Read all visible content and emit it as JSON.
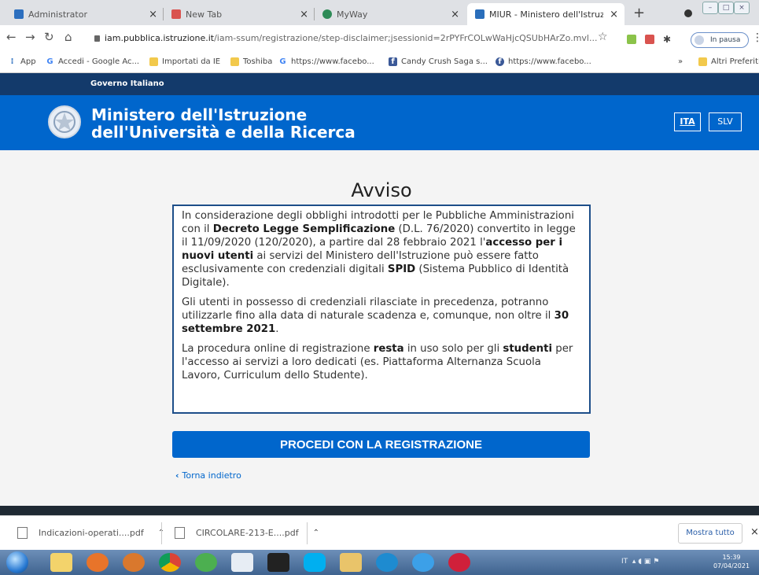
{
  "browser": {
    "tabs": [
      {
        "title": "Administrator",
        "icon": "outlook-icon",
        "color": "#2c6fbf"
      },
      {
        "title": "New Tab",
        "icon": "newtab-icon",
        "color": "#d9534f"
      },
      {
        "title": "MyWay",
        "icon": "myway-icon",
        "color": "#2e8b57"
      },
      {
        "title": "MIUR - Ministero dell'Istruzion",
        "icon": "miur-icon",
        "color": "#2a6ebb",
        "active": true
      }
    ],
    "new_tab": "+",
    "url_host": "iam.pubblica.istruzione.it",
    "url_path": "/iam-ssum/registrazione/step-disclaimer;jsessionid=2rPYFrCOLwWaHjcQSUbHArZo.mvl...",
    "pause_label": "In pausa",
    "bookmarks": [
      {
        "label": "App",
        "icon": "apps-icon"
      },
      {
        "label": "Accedi - Google Ac...",
        "icon": "google-icon"
      },
      {
        "label": "Importati da IE",
        "icon": "folder-icon"
      },
      {
        "label": "Toshiba",
        "icon": "folder-icon"
      },
      {
        "label": "https://www.facebo...",
        "icon": "google-icon"
      },
      {
        "label": "Candy Crush Saga s...",
        "icon": "facebook-icon"
      },
      {
        "label": "https://www.facebo...",
        "icon": "facebook-round-icon"
      }
    ],
    "bookmarks_overflow": "»",
    "other_bookmarks": "Altri Preferiti"
  },
  "page": {
    "gov_label": "Governo Italiano",
    "ministry_line1": "Ministero dell'Istruzione",
    "ministry_line2": "dell'Università e della Ricerca",
    "lang_ita": "ITA",
    "lang_slv": "SLV",
    "notice_title": "Avviso",
    "p1": [
      {
        "t": "In considerazione degli obblighi introdotti per le Pubbliche Amministrazioni con il ",
        "b": false
      },
      {
        "t": "Decreto Legge Semplificazione",
        "b": true
      },
      {
        "t": " (D.L. 76/2020) convertito in legge il 11/09/2020 (120/2020), a partire dal 28 febbraio 2021 l'",
        "b": false
      },
      {
        "t": "accesso per i nuovi utenti",
        "b": true
      },
      {
        "t": " ai servizi del Ministero dell'Istruzione può essere fatto esclusivamente con credenziali digitali ",
        "b": false
      },
      {
        "t": "SPID",
        "b": true
      },
      {
        "t": " (Sistema Pubblico di Identità Digitale).",
        "b": false
      }
    ],
    "p2": [
      {
        "t": "Gli utenti in possesso di credenziali rilasciate in precedenza, potranno utilizzarle fino alla data di naturale scadenza e, comunque, non oltre il ",
        "b": false
      },
      {
        "t": "30 settembre 2021",
        "b": true
      },
      {
        "t": ".",
        "b": false
      }
    ],
    "p3": [
      {
        "t": "La procedura online di registrazione ",
        "b": false
      },
      {
        "t": "resta",
        "b": true
      },
      {
        "t": " in uso solo per gli ",
        "b": false
      },
      {
        "t": "studenti",
        "b": true
      },
      {
        "t": " per l'accesso ai servizi a loro dedicati (es. Piattaforma Alternanza Scuola Lavoro, Curriculum dello Studente).",
        "b": false
      }
    ],
    "proceed_button": "PROCEDI CON LA REGISTRAZIONE",
    "back_link": "Torna indietro"
  },
  "downloads": {
    "items": [
      "Indicazioni-operati....pdf",
      "CIRCOLARE-213-E....pdf"
    ],
    "show_all": "Mostra tutto"
  },
  "taskbar": {
    "tray_lang": "IT",
    "time": "15:39",
    "date": "07/04/2021",
    "icons": [
      "explorer-icon",
      "firefox-icon",
      "media-icon",
      "chrome-icon",
      "cleaner-icon",
      "notepad-icon",
      "game-icon",
      "skype-icon",
      "folder-icon",
      "edge-icon",
      "ie-icon",
      "opera-icon"
    ]
  },
  "colors": {
    "brand_blue": "#0066cc",
    "gov_bar": "#133a6b",
    "notice_border": "#1d4e89"
  }
}
